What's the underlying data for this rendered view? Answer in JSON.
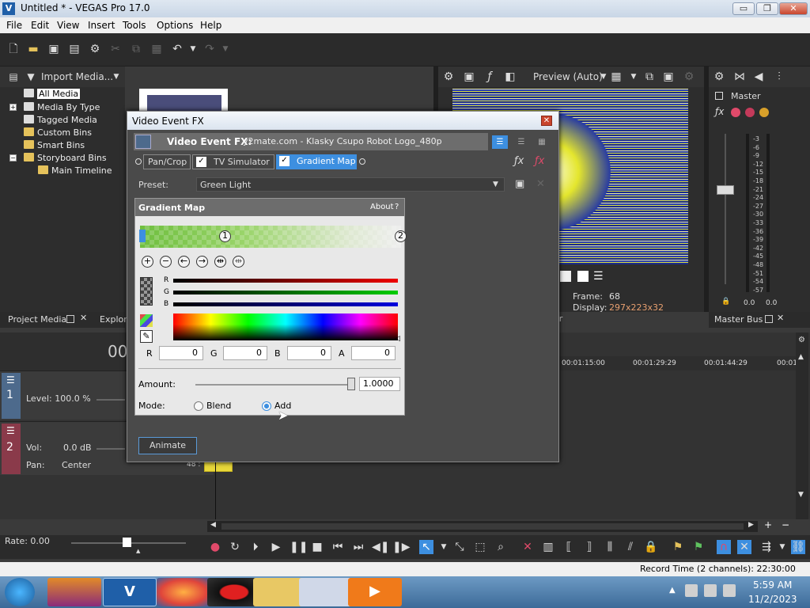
{
  "window": {
    "title": "Untitled * - VEGAS Pro 17.0",
    "app_icon": "V",
    "minimize": "▭",
    "restore": "❐",
    "close": "✕"
  },
  "menu": [
    "File",
    "Edit",
    "View",
    "Insert",
    "Tools",
    "Options",
    "Help"
  ],
  "project_media": {
    "import_label": "Import Media...",
    "tree": [
      {
        "label": "All Media",
        "selected": true
      },
      {
        "label": "Media By Type"
      },
      {
        "label": "Tagged Media"
      },
      {
        "label": "Custom Bins"
      },
      {
        "label": "Smart Bins"
      },
      {
        "label": "Storyboard Bins"
      },
      {
        "label": "Main Timeline"
      }
    ],
    "tabs": {
      "project_media": "Project Media",
      "explorer": "Explor"
    }
  },
  "preview": {
    "mode_label": "Preview (Auto)",
    "frame_label": "Frame:",
    "frame_value": "68",
    "display_label": "Display:",
    "display_value": "297x223x32",
    "tab_partial": "er"
  },
  "master": {
    "label": "Master",
    "bus_tab": "Master Bus",
    "scale": [
      "3",
      "6",
      "9",
      "12",
      "15",
      "18",
      "21",
      "24",
      "27",
      "30",
      "33",
      "36",
      "39",
      "42",
      "45",
      "48",
      "51",
      "54",
      "57"
    ],
    "left_value": "0.0",
    "right_value": "0.0"
  },
  "dialog": {
    "title": "Video Event FX",
    "header_label": "Video Event FX:",
    "header_value": "y2mate.com - Klasky Csupo Robot Logo_480p",
    "chain": [
      {
        "label": "Pan/Crop",
        "checked": false
      },
      {
        "label": "TV Simulator",
        "checked": true
      },
      {
        "label": "Gradient Map",
        "checked": true,
        "active": true
      }
    ],
    "preset_label": "Preset:",
    "preset_value": "Green  Light",
    "plugin": {
      "title": "Gradient Map",
      "about": "About",
      "help": "?",
      "stop1": "1",
      "stop2": "2",
      "channels": {
        "r": "R",
        "g": "G",
        "b": "B",
        "a": "A"
      },
      "values": {
        "r": "0",
        "g": "0",
        "b": "0",
        "a": "0"
      },
      "amount_label": "Amount:",
      "amount_value": "1.0000",
      "mode_label": "Mode:",
      "mode_options": [
        "Blend",
        "Add"
      ],
      "mode_selected": "Add"
    },
    "animate_label": "Animate"
  },
  "timeline": {
    "timecode_partial": "00",
    "track1": {
      "number": "1",
      "level_label": "Level: 100.0 %"
    },
    "track2": {
      "number": "2",
      "vol_label": "Vol:",
      "vol_value": "0.0 dB",
      "pan_label": "Pan:",
      "pan_value": "Center"
    },
    "ruler": [
      "00:01:15:00",
      "00:01:29:29",
      "00:01:44:29",
      "00:01"
    ],
    "clip_marker": "48 :"
  },
  "transport": {
    "rate_label": "Rate: 0.00"
  },
  "status": {
    "record_time": "Record Time (2 channels): 22:30:00"
  },
  "taskbar": {
    "time": "5:59 AM",
    "date": "11/2/2023"
  },
  "colors": {
    "accent": "#3d8fe0",
    "dark_bg": "#2d2d2d",
    "video_track": "#4d6a8c",
    "audio_track": "#8a3a4a"
  }
}
